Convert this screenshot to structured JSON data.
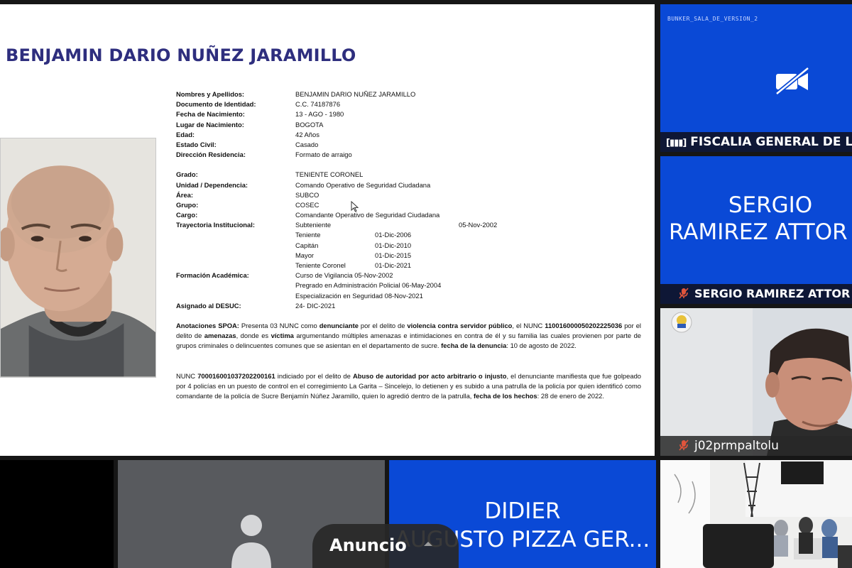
{
  "document": {
    "title": "BENJAMIN DARIO NUÑEZ JARAMILLO",
    "fields_a": [
      {
        "label": "Nombres y Apellidos:",
        "value": "BENJAMIN DARIO NUÑEZ JARAMILLO"
      },
      {
        "label": "Documento de Identidad:",
        "value": "C.C. 74187876"
      },
      {
        "label": "Fecha de Nacimiento:",
        "value": "13 - AGO - 1980"
      },
      {
        "label": "Lugar de Nacimiento:",
        "value": "BOGOTA"
      },
      {
        "label": "Edad:",
        "value": "42 Años"
      },
      {
        "label": "Estado Civil:",
        "value": "Casado"
      },
      {
        "label": "Dirección Residencia:",
        "value": "Formato de arraigo"
      }
    ],
    "fields_b": [
      {
        "label": "Grado:",
        "value": "TENIENTE CORONEL"
      },
      {
        "label": "Unidad / Dependencia:",
        "value": "Comando Operativo de Seguridad Ciudadana"
      },
      {
        "label": "Área:",
        "value": "SUBCO"
      },
      {
        "label": "Grupo:",
        "value": "COSEC"
      },
      {
        "label": "Cargo:",
        "value": "Comandante Operativo de Seguridad Ciudadana"
      }
    ],
    "trajectory": {
      "label": "Trayectoria Institucional:",
      "rows": [
        {
          "rank": "Subteniente",
          "date": "05-Nov-2002"
        },
        {
          "rank": "Teniente",
          "date": "01-Dic-2006"
        },
        {
          "rank": "Capitán",
          "date": "01-Dic-2010"
        },
        {
          "rank": "Mayor",
          "date": "01-Dic-2015"
        },
        {
          "rank": "Teniente Coronel",
          "date": "01-Dic-2021"
        }
      ]
    },
    "education": {
      "label": "Formación Académica:",
      "rows": [
        "Curso de Vigilancia 05-Nov-2002",
        "Pregrado en Administración Policial 06-May-2004",
        "Especialización en Seguridad 08-Nov-2021"
      ]
    },
    "assigned": {
      "label": "Asignado al DESUC:",
      "value": "24- DIC-2021"
    },
    "para1": {
      "label": "Anotaciones SPOA:",
      "t1": " Presenta 03 NUNC como ",
      "b1": "denunciante",
      "t2": " por el delito de ",
      "b2": "violencia contra servidor público",
      "t3": ", el NUNC ",
      "b3": "110016000050202225036",
      "t4": " por el delito de ",
      "b4": "amenazas",
      "t5": ", donde es ",
      "b5": "víctima",
      "t6": " argumentando múltiples amenazas e intimidaciones en contra de él y su familia las cuales provienen por parte de grupos criminales o delincuentes comunes que se asientan en el departamento de sucre. ",
      "b6": "fecha de la denuncia",
      "t7": ": 10 de agosto de 2022."
    },
    "para2": {
      "t1": "NUNC ",
      "b1": "700016001037202200161",
      "t2": " indiciado por el delito de ",
      "b2": "Abuso de autoridad por acto arbitrario o injusto",
      "t3": ", el denunciante manifiesta que fue golpeado por 4 policías en un puesto de control en el corregimiento La Garita – Sincelejo, lo detienen y es subido a una patrulla de la policía por quien identificó como comandante de la policía de Sucre Benjamín Núñez Jaramillo, quien lo agredió dentro de la patrulla, ",
      "b3": "fecha de los hechos",
      "t4": ": 28 de enero de 2022."
    }
  },
  "tiles": {
    "fiscalia": {
      "top_label": "BUNKER_SALA_DE_VERSION_2",
      "name": "FISCALIA GENERAL DE LA",
      "icon": "camera-off-icon"
    },
    "sergio": {
      "big_line1": "SERGIO",
      "big_line2": "RAMIREZ ATTOR",
      "name": "SERGIO RAMIREZ ATTOR",
      "icon": "mic-off-icon"
    },
    "participant": {
      "name": "j02prmpaltolu",
      "icon": "mic-off-icon"
    },
    "didier": {
      "line1": "DIDIER",
      "line2": "AUGUSTO PIZZA GER..."
    }
  },
  "ad": {
    "label": "Anuncio",
    "icon": "chevron-up-icon"
  },
  "colors": {
    "tile_blue": "#0a49d6",
    "title_navy": "#2e2e7e",
    "namebar": "#0f1428"
  }
}
